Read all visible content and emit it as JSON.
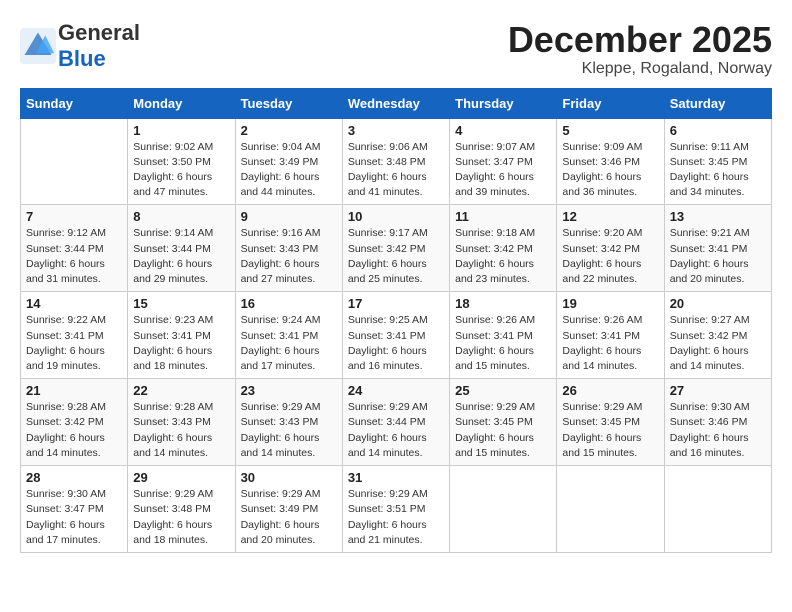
{
  "header": {
    "logo_general": "General",
    "logo_blue": "Blue",
    "month_year": "December 2025",
    "location": "Kleppe, Rogaland, Norway"
  },
  "days_of_week": [
    "Sunday",
    "Monday",
    "Tuesday",
    "Wednesday",
    "Thursday",
    "Friday",
    "Saturday"
  ],
  "weeks": [
    [
      {
        "day": "",
        "info": ""
      },
      {
        "day": "1",
        "info": "Sunrise: 9:02 AM\nSunset: 3:50 PM\nDaylight: 6 hours\nand 47 minutes."
      },
      {
        "day": "2",
        "info": "Sunrise: 9:04 AM\nSunset: 3:49 PM\nDaylight: 6 hours\nand 44 minutes."
      },
      {
        "day": "3",
        "info": "Sunrise: 9:06 AM\nSunset: 3:48 PM\nDaylight: 6 hours\nand 41 minutes."
      },
      {
        "day": "4",
        "info": "Sunrise: 9:07 AM\nSunset: 3:47 PM\nDaylight: 6 hours\nand 39 minutes."
      },
      {
        "day": "5",
        "info": "Sunrise: 9:09 AM\nSunset: 3:46 PM\nDaylight: 6 hours\nand 36 minutes."
      },
      {
        "day": "6",
        "info": "Sunrise: 9:11 AM\nSunset: 3:45 PM\nDaylight: 6 hours\nand 34 minutes."
      }
    ],
    [
      {
        "day": "7",
        "info": "Sunrise: 9:12 AM\nSunset: 3:44 PM\nDaylight: 6 hours\nand 31 minutes."
      },
      {
        "day": "8",
        "info": "Sunrise: 9:14 AM\nSunset: 3:44 PM\nDaylight: 6 hours\nand 29 minutes."
      },
      {
        "day": "9",
        "info": "Sunrise: 9:16 AM\nSunset: 3:43 PM\nDaylight: 6 hours\nand 27 minutes."
      },
      {
        "day": "10",
        "info": "Sunrise: 9:17 AM\nSunset: 3:42 PM\nDaylight: 6 hours\nand 25 minutes."
      },
      {
        "day": "11",
        "info": "Sunrise: 9:18 AM\nSunset: 3:42 PM\nDaylight: 6 hours\nand 23 minutes."
      },
      {
        "day": "12",
        "info": "Sunrise: 9:20 AM\nSunset: 3:42 PM\nDaylight: 6 hours\nand 22 minutes."
      },
      {
        "day": "13",
        "info": "Sunrise: 9:21 AM\nSunset: 3:41 PM\nDaylight: 6 hours\nand 20 minutes."
      }
    ],
    [
      {
        "day": "14",
        "info": "Sunrise: 9:22 AM\nSunset: 3:41 PM\nDaylight: 6 hours\nand 19 minutes."
      },
      {
        "day": "15",
        "info": "Sunrise: 9:23 AM\nSunset: 3:41 PM\nDaylight: 6 hours\nand 18 minutes."
      },
      {
        "day": "16",
        "info": "Sunrise: 9:24 AM\nSunset: 3:41 PM\nDaylight: 6 hours\nand 17 minutes."
      },
      {
        "day": "17",
        "info": "Sunrise: 9:25 AM\nSunset: 3:41 PM\nDaylight: 6 hours\nand 16 minutes."
      },
      {
        "day": "18",
        "info": "Sunrise: 9:26 AM\nSunset: 3:41 PM\nDaylight: 6 hours\nand 15 minutes."
      },
      {
        "day": "19",
        "info": "Sunrise: 9:26 AM\nSunset: 3:41 PM\nDaylight: 6 hours\nand 14 minutes."
      },
      {
        "day": "20",
        "info": "Sunrise: 9:27 AM\nSunset: 3:42 PM\nDaylight: 6 hours\nand 14 minutes."
      }
    ],
    [
      {
        "day": "21",
        "info": "Sunrise: 9:28 AM\nSunset: 3:42 PM\nDaylight: 6 hours\nand 14 minutes."
      },
      {
        "day": "22",
        "info": "Sunrise: 9:28 AM\nSunset: 3:43 PM\nDaylight: 6 hours\nand 14 minutes."
      },
      {
        "day": "23",
        "info": "Sunrise: 9:29 AM\nSunset: 3:43 PM\nDaylight: 6 hours\nand 14 minutes."
      },
      {
        "day": "24",
        "info": "Sunrise: 9:29 AM\nSunset: 3:44 PM\nDaylight: 6 hours\nand 14 minutes."
      },
      {
        "day": "25",
        "info": "Sunrise: 9:29 AM\nSunset: 3:45 PM\nDaylight: 6 hours\nand 15 minutes."
      },
      {
        "day": "26",
        "info": "Sunrise: 9:29 AM\nSunset: 3:45 PM\nDaylight: 6 hours\nand 15 minutes."
      },
      {
        "day": "27",
        "info": "Sunrise: 9:30 AM\nSunset: 3:46 PM\nDaylight: 6 hours\nand 16 minutes."
      }
    ],
    [
      {
        "day": "28",
        "info": "Sunrise: 9:30 AM\nSunset: 3:47 PM\nDaylight: 6 hours\nand 17 minutes."
      },
      {
        "day": "29",
        "info": "Sunrise: 9:29 AM\nSunset: 3:48 PM\nDaylight: 6 hours\nand 18 minutes."
      },
      {
        "day": "30",
        "info": "Sunrise: 9:29 AM\nSunset: 3:49 PM\nDaylight: 6 hours\nand 20 minutes."
      },
      {
        "day": "31",
        "info": "Sunrise: 9:29 AM\nSunset: 3:51 PM\nDaylight: 6 hours\nand 21 minutes."
      },
      {
        "day": "",
        "info": ""
      },
      {
        "day": "",
        "info": ""
      },
      {
        "day": "",
        "info": ""
      }
    ]
  ]
}
